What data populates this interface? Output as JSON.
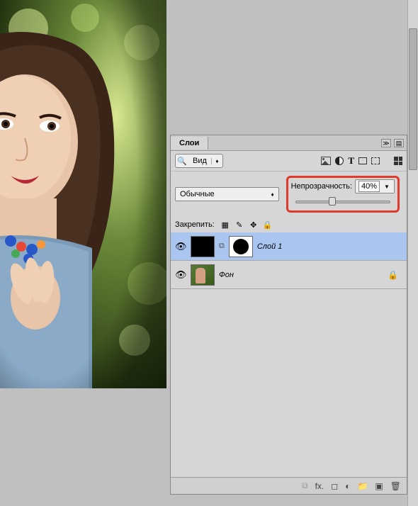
{
  "panel": {
    "tab_label": "Слои",
    "filter_label": "Вид",
    "blend_mode": "Обычные",
    "opacity_label": "Непрозрачность:",
    "opacity_value": "40%",
    "lock_label": "Закрепить:"
  },
  "layers": [
    {
      "name": "Слой 1",
      "visible": true,
      "selected": true,
      "has_mask": true,
      "locked": false
    },
    {
      "name": "Фон",
      "visible": true,
      "selected": false,
      "has_mask": false,
      "locked": true
    }
  ],
  "icons": {
    "search": "🔍",
    "eye": "👁",
    "link": "⧉",
    "lock": "🔒",
    "pixel_lock": "▦",
    "brush": "✎",
    "move": "✥",
    "trash": "🗑",
    "new": "▣",
    "folder": "📁",
    "mask": "◐",
    "fx": "fx.",
    "chain": "⧉",
    "type": "T",
    "dropdown": "▼",
    "arrows": "≫",
    "menu": "▤",
    "collapse": "▾"
  }
}
